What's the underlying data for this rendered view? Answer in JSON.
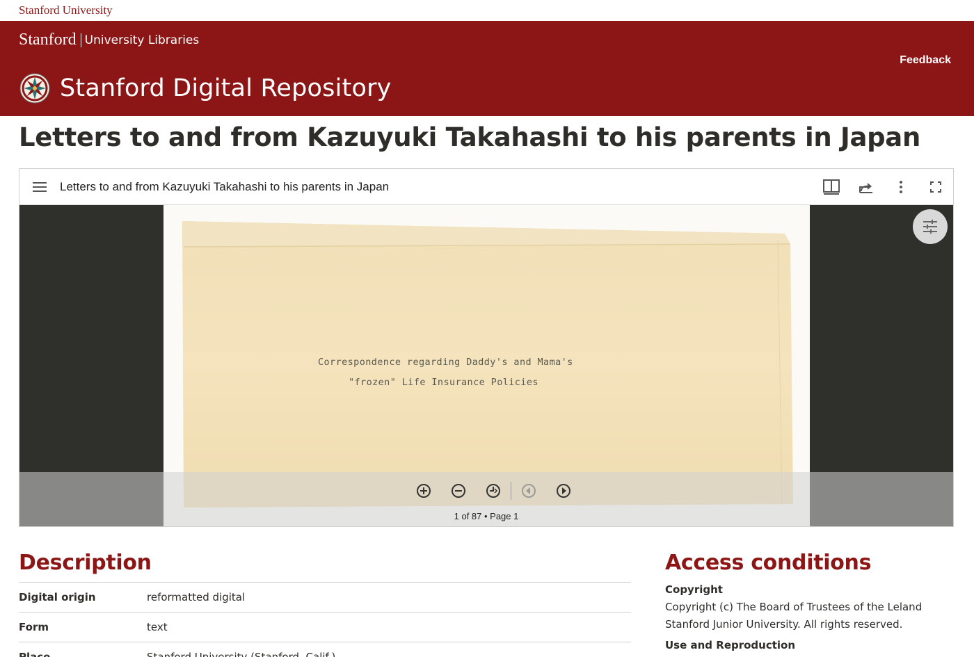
{
  "identity": {
    "label": "Stanford University"
  },
  "masthead": {
    "logo_stanford": "Stanford",
    "logo_libraries": "University Libraries",
    "feedback": "Feedback",
    "site_title": "Stanford Digital Repository",
    "emblem_icon": "sdr-emblem-icon"
  },
  "page_title": "Letters to and from Kazuyuki Takahashi to his parents in Japan",
  "viewer": {
    "title": "Letters to and from Kazuyuki Takahashi to his parents in Japan",
    "toolbar_icons": [
      "menu-icon",
      "book-view-icon",
      "share-icon",
      "more-options-icon",
      "fullscreen-icon"
    ],
    "image_text_line1": "Correspondence regarding Daddy's and Mama's",
    "image_text_line2": "\"frozen\" Life Insurance Policies",
    "controls": [
      "zoom-in-icon",
      "zoom-out-icon",
      "reset-zoom-icon",
      "previous-page-icon",
      "next-page-icon"
    ],
    "page_count": "1 of 87 • Page 1",
    "accent": "#8c1515"
  },
  "description": {
    "title": "Description",
    "rows": [
      {
        "label": "Digital origin",
        "value": "reformatted digital"
      },
      {
        "label": "Form",
        "value": "text"
      },
      {
        "label": "Place",
        "value": "Stanford University (Stanford, Calif.)"
      }
    ]
  },
  "access": {
    "title": "Access conditions",
    "copyright_label": "Copyright",
    "copyright_text": "Copyright (c) The Board of Trustees of the Leland Stanford Junior University. All rights reserved.",
    "use_label": "Use and Reproduction"
  }
}
